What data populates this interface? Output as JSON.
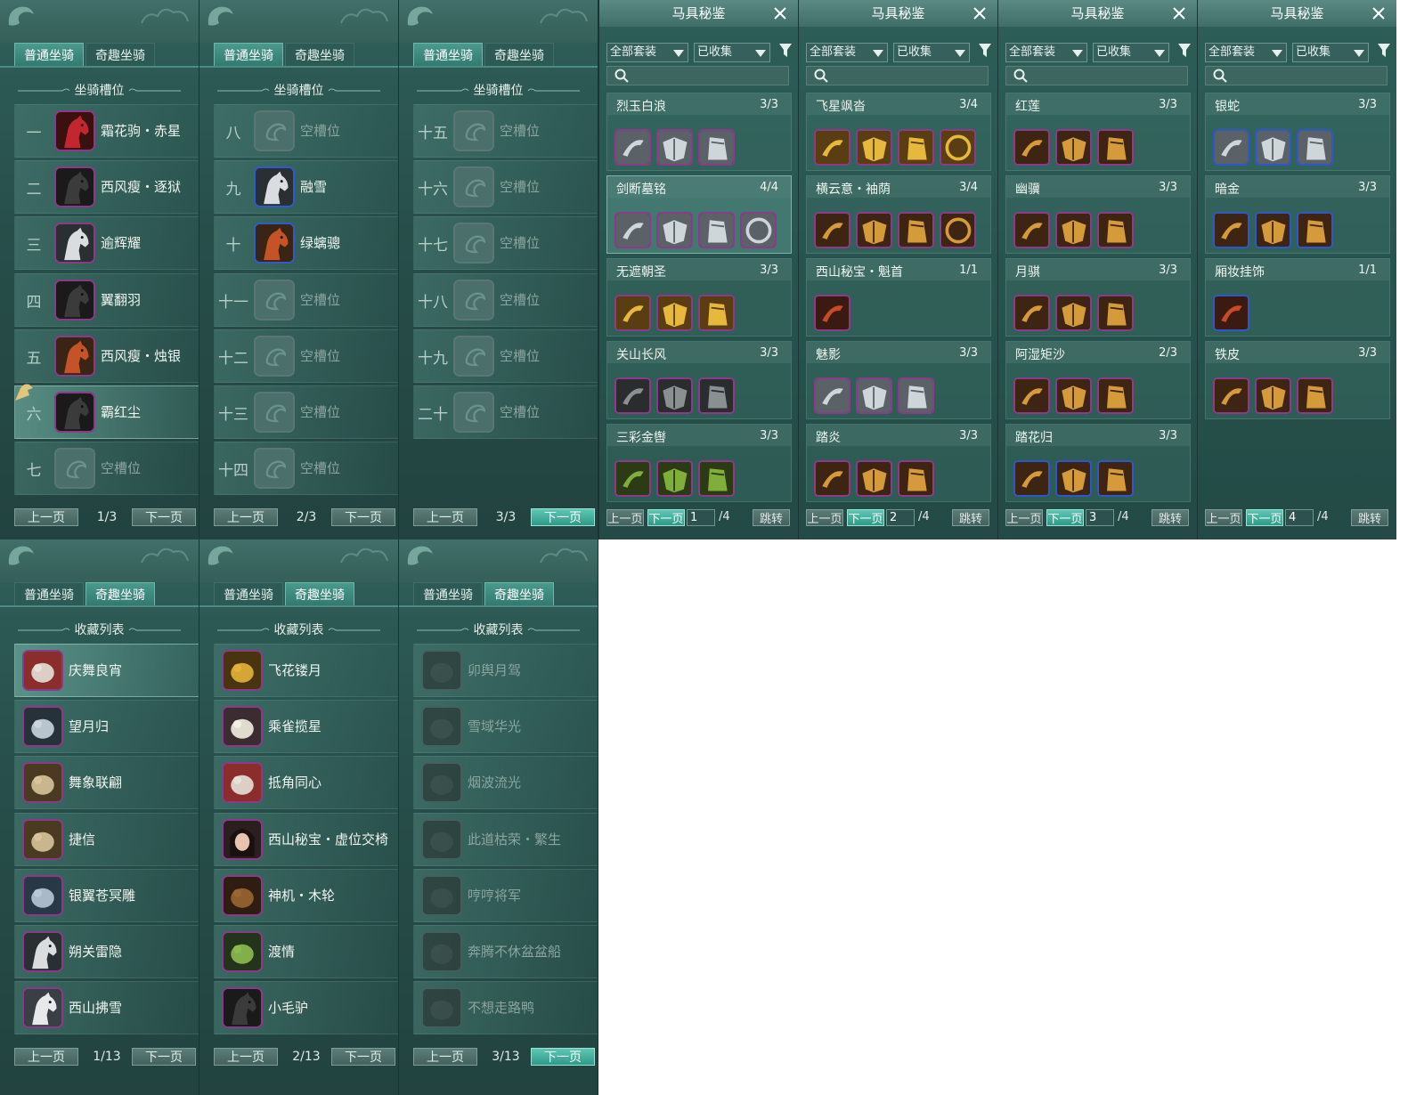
{
  "tabs": {
    "normal": "普通坐骑",
    "fun": "奇趣坐骑"
  },
  "slots_title": "坐骑槽位",
  "collection_title": "收藏列表",
  "prev": "上一页",
  "next": "下一页",
  "slot_pages": [
    {
      "page": "1/3",
      "rows": [
        {
          "num": "一",
          "name": "霜花驹・赤星",
          "kind": "red",
          "frame": "purple"
        },
        {
          "num": "二",
          "name": "西风瘦・逐狱",
          "kind": "black",
          "frame": "purple"
        },
        {
          "num": "三",
          "name": "逾辉耀",
          "kind": "white",
          "frame": "purple"
        },
        {
          "num": "四",
          "name": "翼翻羽",
          "kind": "black",
          "frame": "purple"
        },
        {
          "num": "五",
          "name": "西风瘦・烛银",
          "kind": "chestnut",
          "frame": "purple"
        },
        {
          "num": "六",
          "name": "霸红尘",
          "kind": "black",
          "frame": "purple",
          "selected": true
        },
        {
          "num": "七",
          "name": "空槽位",
          "kind": "empty",
          "frame": "gray"
        }
      ]
    },
    {
      "page": "2/3",
      "rows": [
        {
          "num": "八",
          "name": "空槽位",
          "kind": "empty",
          "frame": "gray"
        },
        {
          "num": "九",
          "name": "融雪",
          "kind": "white",
          "frame": "blue"
        },
        {
          "num": "十",
          "name": "绿螭骢",
          "kind": "chestnut",
          "frame": "blue"
        },
        {
          "num": "十一",
          "name": "空槽位",
          "kind": "empty",
          "frame": "gray"
        },
        {
          "num": "十二",
          "name": "空槽位",
          "kind": "empty",
          "frame": "gray"
        },
        {
          "num": "十三",
          "name": "空槽位",
          "kind": "empty",
          "frame": "gray"
        },
        {
          "num": "十四",
          "name": "空槽位",
          "kind": "empty",
          "frame": "gray"
        }
      ]
    },
    {
      "page": "3/3",
      "rows": [
        {
          "num": "十五",
          "name": "空槽位",
          "kind": "empty",
          "frame": "gray"
        },
        {
          "num": "十六",
          "name": "空槽位",
          "kind": "empty",
          "frame": "gray"
        },
        {
          "num": "十七",
          "name": "空槽位",
          "kind": "empty",
          "frame": "gray"
        },
        {
          "num": "十八",
          "name": "空槽位",
          "kind": "empty",
          "frame": "gray"
        },
        {
          "num": "十九",
          "name": "空槽位",
          "kind": "empty",
          "frame": "gray"
        },
        {
          "num": "二十",
          "name": "空槽位",
          "kind": "empty",
          "frame": "gray"
        }
      ]
    }
  ],
  "collection_pages": [
    {
      "page": "1/13",
      "rows": [
        {
          "name": "庆舞良宵",
          "kind": "lion",
          "owned": true,
          "selected": true
        },
        {
          "name": "望月归",
          "kind": "crane",
          "owned": true
        },
        {
          "name": "舞象联翩",
          "kind": "elephant",
          "owned": true
        },
        {
          "name": "捷信",
          "kind": "elephant",
          "owned": true
        },
        {
          "name": "银翼苍冥雕",
          "kind": "eagle",
          "owned": true
        },
        {
          "name": "朔关雷隐",
          "kind": "white",
          "owned": true
        },
        {
          "name": "西山拂雪",
          "kind": "deer",
          "owned": true
        }
      ]
    },
    {
      "page": "2/13",
      "rows": [
        {
          "name": "飞花镂月",
          "kind": "gold",
          "owned": true
        },
        {
          "name": "乘雀揽星",
          "kind": "lotus",
          "owned": true
        },
        {
          "name": "抵角同心",
          "kind": "lion",
          "owned": true
        },
        {
          "name": "西山秘宝・虚位交椅",
          "kind": "girl",
          "owned": true
        },
        {
          "name": "神机・木轮",
          "kind": "wood",
          "owned": true
        },
        {
          "name": "渡情",
          "kind": "bamboo",
          "owned": true
        },
        {
          "name": "小毛驴",
          "kind": "black",
          "owned": true
        }
      ]
    },
    {
      "page": "3/13",
      "rows": [
        {
          "name": "卯舆月驾",
          "kind": "shadow",
          "owned": false
        },
        {
          "name": "雪域华光",
          "kind": "shadow",
          "owned": false
        },
        {
          "name": "烟波流光",
          "kind": "shadow",
          "owned": false
        },
        {
          "name": "此道枯荣・繁生",
          "kind": "shadow",
          "owned": false
        },
        {
          "name": "哼哼将军",
          "kind": "shadow",
          "owned": false
        },
        {
          "name": "奔腾不休盆盆船",
          "kind": "shadow",
          "owned": false
        },
        {
          "name": "不想走路鸭",
          "kind": "shadow",
          "owned": false
        }
      ]
    }
  ],
  "codex": {
    "title": "马具秘鉴",
    "filter_all": "全部套装",
    "filter_collected": "已收集",
    "jump": "跳转",
    "total": "/4",
    "pages": [
      {
        "page": "1",
        "sets": [
          {
            "name": "烈玉白浪",
            "count": "3/3",
            "tone": "silver",
            "n": 3,
            "frame": "purple"
          },
          {
            "name": "剑断墓铭",
            "count": "4/4",
            "tone": "silver",
            "n": 4,
            "frame": "purple",
            "selected": true
          },
          {
            "name": "无遮朝圣",
            "count": "3/3",
            "tone": "gold",
            "n": 3,
            "frame": "purple"
          },
          {
            "name": "关山长风",
            "count": "3/3",
            "tone": "dark",
            "n": 3,
            "frame": "purple"
          },
          {
            "name": "三彩金辔",
            "count": "3/3",
            "tone": "green",
            "n": 3,
            "frame": "purple"
          }
        ]
      },
      {
        "page": "2",
        "sets": [
          {
            "name": "飞星飒沓",
            "count": "3/4",
            "tone": "gold",
            "n": 4,
            "frame": "purple"
          },
          {
            "name": "横云意・袖荫",
            "count": "3/4",
            "tone": "bronze",
            "n": 4,
            "frame": "purple"
          },
          {
            "name": "西山秘宝・魁首",
            "count": "1/1",
            "tone": "red",
            "n": 1,
            "frame": "purple"
          },
          {
            "name": "魅影",
            "count": "3/3",
            "tone": "silver",
            "n": 3,
            "frame": "purple"
          },
          {
            "name": "踏炎",
            "count": "3/3",
            "tone": "bronze",
            "n": 3,
            "frame": "purple"
          }
        ]
      },
      {
        "page": "3",
        "sets": [
          {
            "name": "红莲",
            "count": "3/3",
            "tone": "bronze",
            "n": 3,
            "frame": "purple"
          },
          {
            "name": "幽骥",
            "count": "3/3",
            "tone": "bronze",
            "n": 3,
            "frame": "purple"
          },
          {
            "name": "月骐",
            "count": "3/3",
            "tone": "bronze",
            "n": 3,
            "frame": "purple"
          },
          {
            "name": "阿湿矩沙",
            "count": "2/3",
            "tone": "bronze",
            "n": 3,
            "frame": "purple"
          },
          {
            "name": "踏花归",
            "count": "3/3",
            "tone": "bronze",
            "n": 3,
            "frame": "blue"
          }
        ]
      },
      {
        "page": "4",
        "sets": [
          {
            "name": "银蛇",
            "count": "3/3",
            "tone": "silver",
            "n": 3,
            "frame": "blue"
          },
          {
            "name": "暗金",
            "count": "3/3",
            "tone": "bronze",
            "n": 3,
            "frame": "blue"
          },
          {
            "name": "厢妆挂饰",
            "count": "1/1",
            "tone": "red",
            "n": 1,
            "frame": "blue"
          },
          {
            "name": "铁皮",
            "count": "3/3",
            "tone": "bronze",
            "n": 3,
            "frame": "purple"
          }
        ]
      }
    ]
  },
  "colors": {
    "accent": "#3fa899",
    "frame_purple": "#8c3a8a",
    "frame_blue": "#2e58c5",
    "text": "#f1f5ef"
  }
}
